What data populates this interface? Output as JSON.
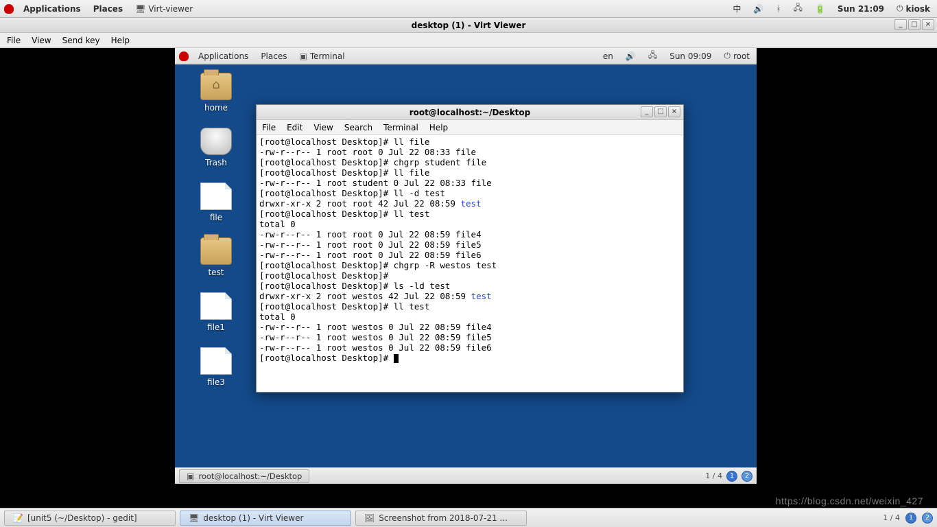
{
  "host_panel": {
    "applications": "Applications",
    "places": "Places",
    "running_app": "Virt-viewer",
    "ime": "中",
    "clock": "Sun 21:09",
    "user": "kiosk"
  },
  "virt_viewer": {
    "title": "desktop (1) - Virt Viewer",
    "menu": {
      "file": "File",
      "view": "View",
      "sendkey": "Send key",
      "help": "Help"
    }
  },
  "guest_panel": {
    "applications": "Applications",
    "places": "Places",
    "running_app": "Terminal",
    "lang": "en",
    "clock": "Sun 09:09",
    "user": "root"
  },
  "desktop_icons": {
    "home": "home",
    "trash": "Trash",
    "file": "file",
    "test": "test",
    "file1": "file1",
    "file3": "file3"
  },
  "terminal": {
    "title": "root@localhost:~/Desktop",
    "menu": {
      "file": "File",
      "edit": "Edit",
      "view": "View",
      "search": "Search",
      "terminal": "Terminal",
      "help": "Help"
    },
    "lines": [
      {
        "t": "[root@localhost Desktop]# ll file"
      },
      {
        "t": "-rw-r--r-- 1 root root 0 Jul 22 08:33 file"
      },
      {
        "t": "[root@localhost Desktop]# chgrp student file"
      },
      {
        "t": "[root@localhost Desktop]# ll file"
      },
      {
        "t": "-rw-r--r-- 1 root student 0 Jul 22 08:33 file"
      },
      {
        "t": "[root@localhost Desktop]# ll -d test"
      },
      {
        "t": "drwxr-xr-x 2 root root 42 Jul 22 08:59 ",
        "link": "test"
      },
      {
        "t": "[root@localhost Desktop]# ll test"
      },
      {
        "t": "total 0"
      },
      {
        "t": "-rw-r--r-- 1 root root 0 Jul 22 08:59 file4"
      },
      {
        "t": "-rw-r--r-- 1 root root 0 Jul 22 08:59 file5"
      },
      {
        "t": "-rw-r--r-- 1 root root 0 Jul 22 08:59 file6"
      },
      {
        "t": "[root@localhost Desktop]# chgrp -R westos test"
      },
      {
        "t": "[root@localhost Desktop]#"
      },
      {
        "t": "[root@localhost Desktop]# ls -ld test"
      },
      {
        "t": "drwxr-xr-x 2 root westos 42 Jul 22 08:59 ",
        "link": "test"
      },
      {
        "t": "[root@localhost Desktop]# ll test"
      },
      {
        "t": "total 0"
      },
      {
        "t": "-rw-r--r-- 1 root westos 0 Jul 22 08:59 file4"
      },
      {
        "t": "-rw-r--r-- 1 root westos 0 Jul 22 08:59 file5"
      },
      {
        "t": "-rw-r--r-- 1 root westos 0 Jul 22 08:59 file6"
      },
      {
        "t": "[root@localhost Desktop]# ",
        "cursor": true
      }
    ]
  },
  "guest_taskbar": {
    "task1": "root@localhost:~/Desktop",
    "pager": "1 / 4"
  },
  "host_taskbar": {
    "task1": "[unit5 (~/Desktop) - gedit]",
    "task2": "desktop (1) - Virt Viewer",
    "task3": "Screenshot from 2018-07-21 ...",
    "pager": "1 / 4"
  },
  "watermark": "https://blog.csdn.net/weixin_427"
}
